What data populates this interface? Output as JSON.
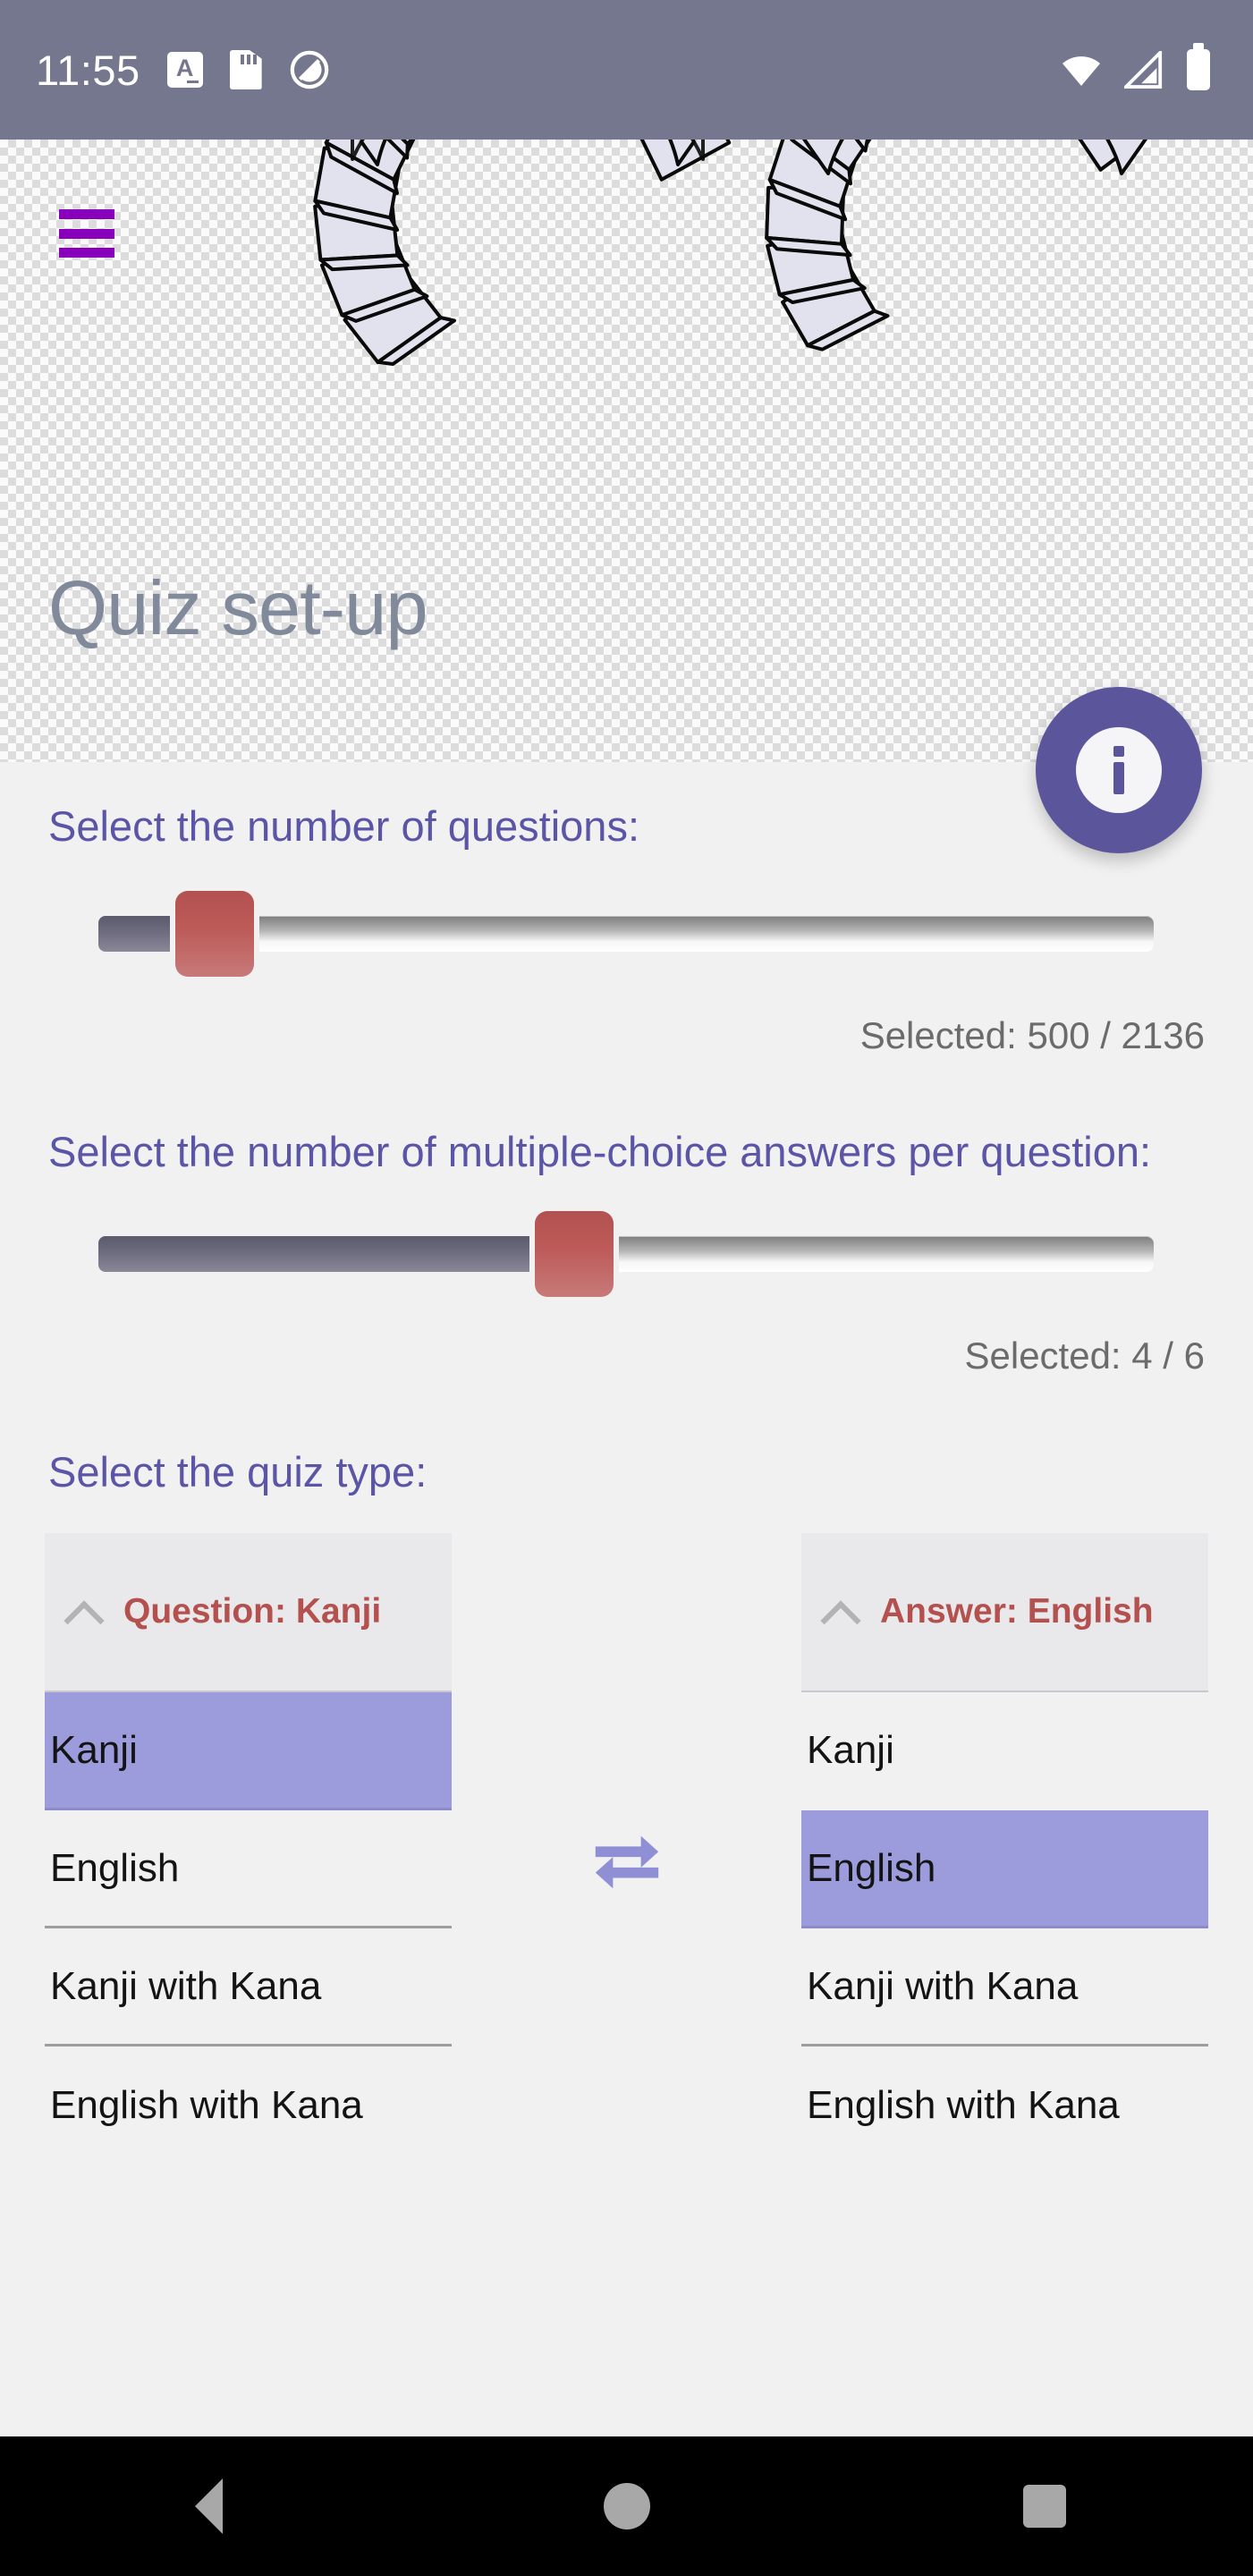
{
  "status_bar": {
    "time": "11:55",
    "left_icons": [
      {
        "name": "spellcheck-a-icon",
        "glyph": "A"
      },
      {
        "name": "sd-card-icon",
        "glyph": "sd"
      },
      {
        "name": "do-not-disturb-icon",
        "glyph": "circle-slash"
      }
    ],
    "right_icons": [
      {
        "name": "wifi-icon"
      },
      {
        "name": "cellular-signal-icon"
      },
      {
        "name": "battery-icon"
      }
    ],
    "background_color": "#75778e"
  },
  "header": {
    "menu_label": "hamburger-menu",
    "title": "Quiz set-up",
    "title_color": "#818a9a",
    "accent_color": "#8800bb",
    "hero_illustration": "gear-teeth-illustration"
  },
  "fab": {
    "name": "info-button",
    "label": "i",
    "color": "#5b559c"
  },
  "main": {
    "questions_section": {
      "label": "Select the number of questions:",
      "slider": {
        "name": "question-count-slider",
        "value": 500,
        "min": 1,
        "max": 2136,
        "fill_percent": 11,
        "thumb_percent": 13
      },
      "selected_text": "Selected: 500 / 2136"
    },
    "answers_section": {
      "label": "Select the number of multiple-choice answers per question:",
      "slider": {
        "name": "answer-count-slider",
        "value": 4,
        "min": 2,
        "max": 6,
        "fill_percent": 45,
        "thumb_percent": 47
      },
      "selected_text": "Selected: 4 / 6"
    },
    "quiz_type_section": {
      "label": "Select the quiz type:",
      "swap_icon": "swap-horizontal-icon",
      "question_column": {
        "header": "Question: Kanji",
        "header_color": "#b4504e",
        "chevron": "chevron-up-icon",
        "options": [
          {
            "label": "Kanji",
            "selected": true
          },
          {
            "label": "English",
            "selected": false
          },
          {
            "label": "Kanji with Kana",
            "selected": false
          },
          {
            "label": "English with Kana",
            "selected": false
          }
        ]
      },
      "answer_column": {
        "header": "Answer: English",
        "header_color": "#b4504e",
        "chevron": "chevron-up-icon",
        "options": [
          {
            "label": "Kanji",
            "selected": false
          },
          {
            "label": "English",
            "selected": true
          },
          {
            "label": "Kanji with Kana",
            "selected": false
          },
          {
            "label": "English with Kana",
            "selected": false
          }
        ]
      },
      "selection_highlight_color": "#9c9cdc"
    }
  },
  "nav_bar": {
    "back": "back-button",
    "home": "home-button",
    "recents": "recents-button"
  }
}
